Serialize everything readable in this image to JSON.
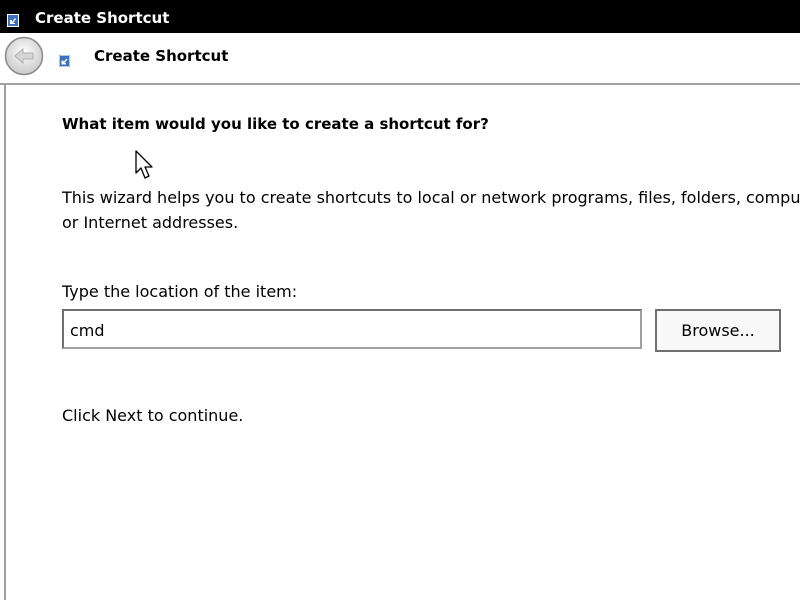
{
  "window": {
    "title": "Create Shortcut"
  },
  "header": {
    "title": "Create Shortcut",
    "back_icon": "back-arrow-icon",
    "shortcut_icon": "shortcut-icon"
  },
  "main": {
    "heading": "What item would you like to create a shortcut for?",
    "description_line1": "This wizard helps you to create shortcuts to local or network programs, files, folders, computers,",
    "description_line2": "or Internet addresses.",
    "location_label": "Type the location of the item:",
    "location_value": "cmd",
    "browse_label": "Browse...",
    "continue_text": "Click Next to continue."
  },
  "colors": {
    "titlebar": "#000000",
    "border": "#a0a0a0"
  }
}
